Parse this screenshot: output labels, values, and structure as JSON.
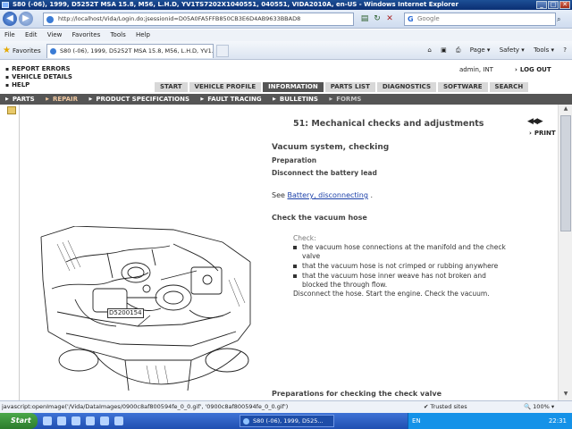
{
  "window": {
    "title": "S80 (-06), 1999, D5252T MSA 15.8, M56, L.H.D, YV1TS7202X1040551, 040551, VIDA2010A, en-US - Windows Internet Explorer",
    "min": "_",
    "max": "□",
    "close": "✕"
  },
  "addressbar": {
    "back": "◀",
    "forward": "▶",
    "url": "http://localhost/Vida/Login.do;jsessionid=D05A0FA5FFB850CB3E6D4AB9633BBAD8",
    "search_placeholder": "Google",
    "google_logo": "G"
  },
  "menubar": [
    "File",
    "Edit",
    "View",
    "Favorites",
    "Tools",
    "Help"
  ],
  "favbar": {
    "favorites_label": "Favorites",
    "tab_title": "S80 (-06), 1999, D5252T MSA 15.8, M56, L.H.D, YV1...",
    "commands": [
      "Page ▾",
      "Safety ▾",
      "Tools ▾",
      "?"
    ]
  },
  "vida": {
    "toplinks": [
      "REPORT ERRORS",
      "VEHICLE DETAILS",
      "HELP"
    ],
    "user": "admin, INT",
    "logout": "LOG OUT",
    "tabs": [
      "START",
      "VEHICLE PROFILE",
      "INFORMATION",
      "PARTS LIST",
      "DIAGNOSTICS",
      "SOFTWARE",
      "SEARCH"
    ],
    "active_tab": "INFORMATION",
    "subnav": [
      "PARTS",
      "REPAIR",
      "PRODUCT SPECIFICATIONS",
      "FAULT TRACING",
      "BULLETINS",
      "FORMS"
    ]
  },
  "doc": {
    "section_title": "51: Mechanical checks and adjustments",
    "nav_arrows": "◀◀ ▶",
    "print": "PRINT",
    "heading": "Vacuum system, checking",
    "preparation": "Preparation",
    "disconnect": "Disconnect the battery lead",
    "see": "See",
    "see_link": "Battery, disconnecting",
    "see_end": ".",
    "check_hose": "Check the vacuum hose",
    "check_label": "Check:",
    "checks": [
      "the vacuum hose connections at the manifold and the check valve",
      "that the vacuum hose is not crimped or rubbing anywhere",
      "that the vacuum hose inner weave has not broken and blocked the through flow."
    ],
    "after_check": "Disconnect the hose. Start the engine. Check the vacuum.",
    "next_heading": "Preparations for checking the check valve",
    "figure_label": "D5200154"
  },
  "statusbar": {
    "message": "javascript:openImage('/Vida/DataImages/0900c8af800594fe_0_0.gif', '0900c8af800594fe_0_0.gif')",
    "trusted": "Trusted sites",
    "zoom": "100%"
  },
  "taskbar": {
    "start": "Start",
    "task": "S80 (-06), 1999, D525...",
    "lang": "EN",
    "clock": "22:31"
  }
}
